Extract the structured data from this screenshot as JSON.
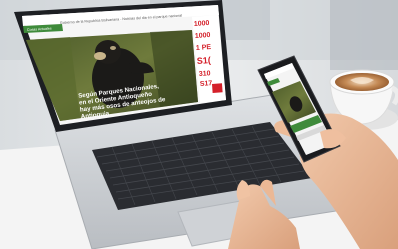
{
  "laptop_screen": {
    "header_text": "Gobierno de la Republica Bolivariana - Noticias del dia en el parque nacional",
    "nav_label": "Cosas Actuales",
    "article_headline_lines": [
      "Según Parques Nacionales,",
      "en el Oriente Antioqueño",
      "hay más osos de anteojos de",
      "Antioquia"
    ],
    "ad_lines": [
      "1000",
      "1000",
      "1 PE",
      "S1(",
      "310",
      "S17"
    ]
  },
  "phone_screen": {
    "nav_label": "Cosas Actuales"
  },
  "colors": {
    "site_green": "#3f8b3b",
    "ad_red": "#d4202a",
    "laptop_body": "#c9ccd1",
    "keyboard": "#2a2c31",
    "table": "#f1f1f1",
    "coffee": "#b57a4a"
  }
}
